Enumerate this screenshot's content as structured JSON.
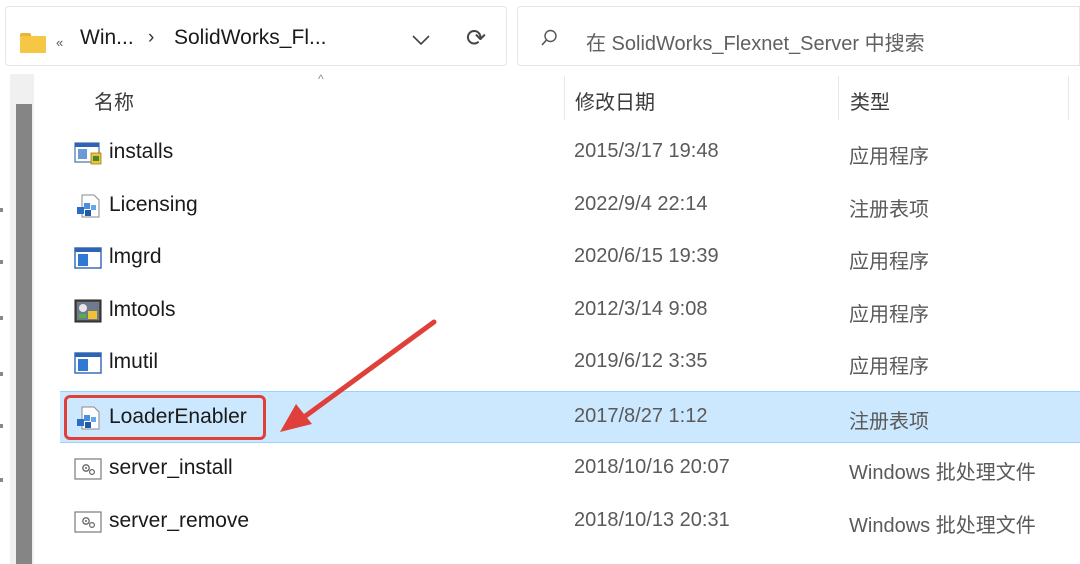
{
  "address": {
    "overflow": "«",
    "crumb1": "Win...",
    "separator": "›",
    "crumb2": "SolidWorks_Fl...",
    "refresh_glyph": "⟳"
  },
  "search": {
    "placeholder": "在 SolidWorks_Flexnet_Server 中搜索"
  },
  "columns": {
    "name": "名称",
    "modified": "修改日期",
    "type": "类型",
    "sort_indicator": "^"
  },
  "files": [
    {
      "name": "installs",
      "modified": "2015/3/17 19:48",
      "type": "应用程序",
      "icon": "installer-app-icon"
    },
    {
      "name": "Licensing",
      "modified": "2022/9/4 22:14",
      "type": "注册表项",
      "icon": "registry-file-icon"
    },
    {
      "name": "lmgrd",
      "modified": "2020/6/15 19:39",
      "type": "应用程序",
      "icon": "window-app-icon"
    },
    {
      "name": "lmtools",
      "modified": "2012/3/14 9:08",
      "type": "应用程序",
      "icon": "tools-app-icon"
    },
    {
      "name": "lmutil",
      "modified": "2019/6/12 3:35",
      "type": "应用程序",
      "icon": "window-app-icon"
    },
    {
      "name": "LoaderEnabler",
      "modified": "2017/8/27 1:12",
      "type": "注册表项",
      "icon": "registry-file-icon",
      "selected": true
    },
    {
      "name": "server_install",
      "modified": "2018/10/16 20:07",
      "type": "Windows 批处理文件",
      "icon": "batch-file-icon"
    },
    {
      "name": "server_remove",
      "modified": "2018/10/13 20:31",
      "type": "Windows 批处理文件",
      "icon": "batch-file-icon"
    }
  ],
  "colors": {
    "selection": "#cce8ff",
    "annotation": "#e0403a",
    "folder": "#f6c744"
  }
}
